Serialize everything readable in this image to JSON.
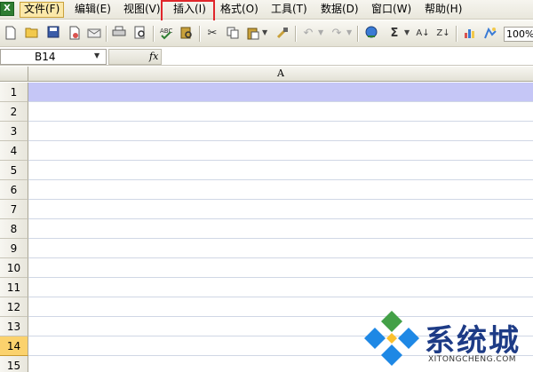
{
  "menu": {
    "items": [
      {
        "label": "文件(F)"
      },
      {
        "label": "编辑(E)"
      },
      {
        "label": "视图(V)"
      },
      {
        "label": "插入(I)"
      },
      {
        "label": "格式(O)"
      },
      {
        "label": "工具(T)"
      },
      {
        "label": "数据(D)"
      },
      {
        "label": "窗口(W)"
      },
      {
        "label": "帮助(H)"
      }
    ],
    "active_item": "文件(F)",
    "highlighted_item": "插入(I)",
    "highlight_color": "#e0262b"
  },
  "toolbar": {
    "icons": [
      "new-icon",
      "open-icon",
      "save-icon",
      "permission-icon",
      "email-icon",
      "print-icon",
      "print-preview-icon",
      "spelling-icon",
      "research-icon",
      "cut-icon",
      "copy-icon",
      "paste-icon",
      "format-painter-icon",
      "undo-icon",
      "redo-icon",
      "hyperlink-icon",
      "autosum-icon",
      "sort-ascending-icon",
      "sort-descending-icon",
      "chart-wizard-icon",
      "drawing-icon"
    ],
    "zoom": "100%"
  },
  "formula_bar": {
    "name_box": "B14",
    "fx_label": "fx",
    "content": ""
  },
  "grid": {
    "column_header": "A",
    "rows": [
      "1",
      "2",
      "3",
      "4",
      "5",
      "6",
      "7",
      "8",
      "9",
      "10",
      "11",
      "12",
      "13",
      "14",
      "15"
    ],
    "selected_row": "14",
    "selected_cell_row": "1",
    "selection_fill": "#c5c6f6"
  },
  "watermark": {
    "text": "系统城",
    "subtext": "XITONGCHENG.COM",
    "colors": [
      "#1e88e5",
      "#43a047",
      "#fbc02d"
    ]
  }
}
